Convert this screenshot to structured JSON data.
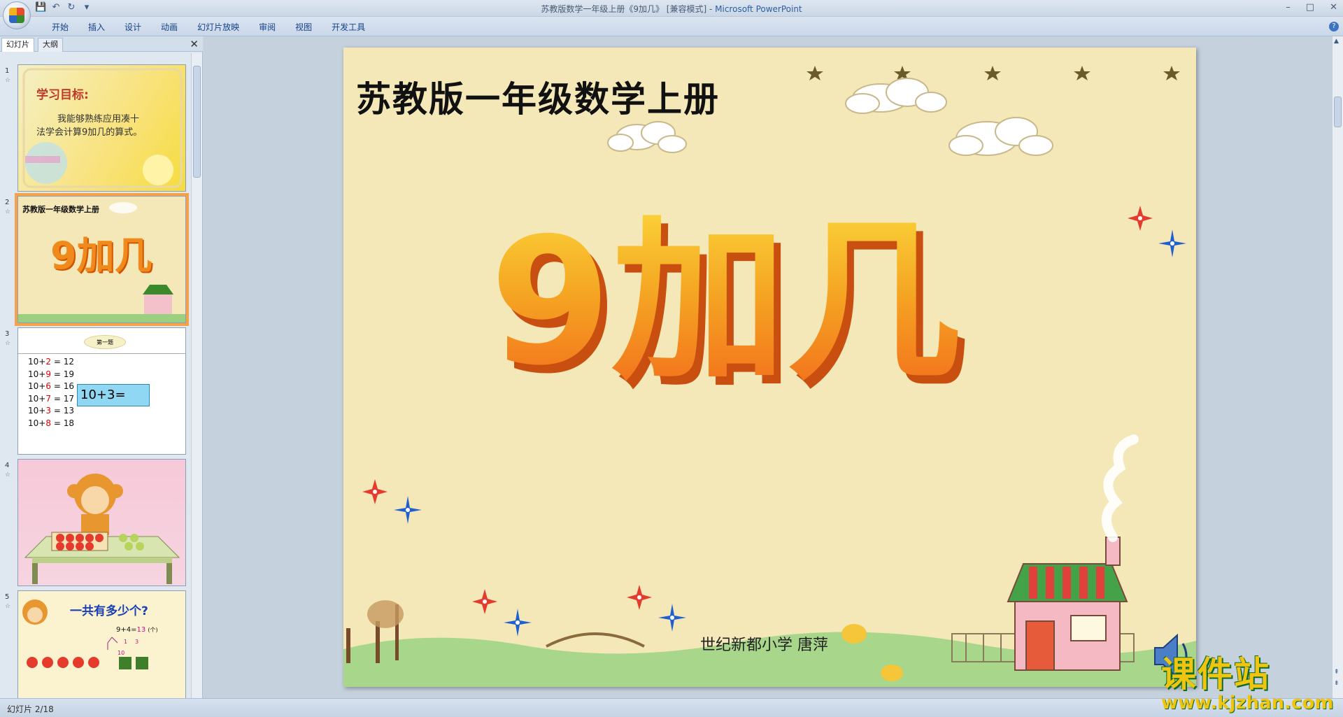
{
  "window": {
    "title_prefix": "苏教版数学一年级上册《9加几》 [兼容模式] - ",
    "app_name": "Microsoft PowerPoint",
    "minimize": "–",
    "maximize": "□",
    "close": "✕"
  },
  "ribbon": {
    "tabs": [
      "开始",
      "插入",
      "设计",
      "动画",
      "幻灯片放映",
      "审阅",
      "视图",
      "开发工具"
    ],
    "help": "?"
  },
  "pane": {
    "tab_slides": "幻灯片",
    "tab_outline": "大纲",
    "close": "✕"
  },
  "thumbnails": [
    {
      "number": "1",
      "title": "学习目标:",
      "text1": "我能够熟练应用凑十",
      "text2": "法学会计算9加几的算式。"
    },
    {
      "number": "2",
      "title": "苏教版一年级数学上册",
      "big": "9加几"
    },
    {
      "number": "3",
      "bubble": "第一题",
      "rows": [
        {
          "a": "10",
          "op": "+",
          "b": "2",
          "eq": "=",
          "r": "12"
        },
        {
          "a": "10",
          "op": "+",
          "b": "9",
          "eq": "=",
          "r": "19"
        },
        {
          "a": "10",
          "op": "+",
          "b": "6",
          "eq": "=",
          "r": "16"
        },
        {
          "a": "10",
          "op": "+",
          "b": "7",
          "eq": "=",
          "r": "17"
        },
        {
          "a": "10",
          "op": "+",
          "b": "3",
          "eq": "=",
          "r": "13"
        },
        {
          "a": "10",
          "op": "+",
          "b": "8",
          "eq": "=",
          "r": "18"
        }
      ],
      "box": "10+3="
    },
    {
      "number": "4"
    },
    {
      "number": "5",
      "title": "一共有多少个?",
      "formula": "9+4=",
      "answer": "13",
      "unit": "(个)",
      "n1": "1",
      "n2": "3",
      "n3": "10"
    }
  ],
  "slide": {
    "title": "苏教版一年级数学上册",
    "big_text": "9加几",
    "author": "世纪新都小学  唐萍"
  },
  "status": {
    "text": "幻灯片 2/18"
  },
  "watermark": {
    "cn": "课件站",
    "url": "www.kjzhan.com"
  },
  "colors": {
    "slide_bg": "#f4e8b8",
    "accent_orange": "#f08a1c",
    "selected_thumb": "#f6a24a"
  }
}
